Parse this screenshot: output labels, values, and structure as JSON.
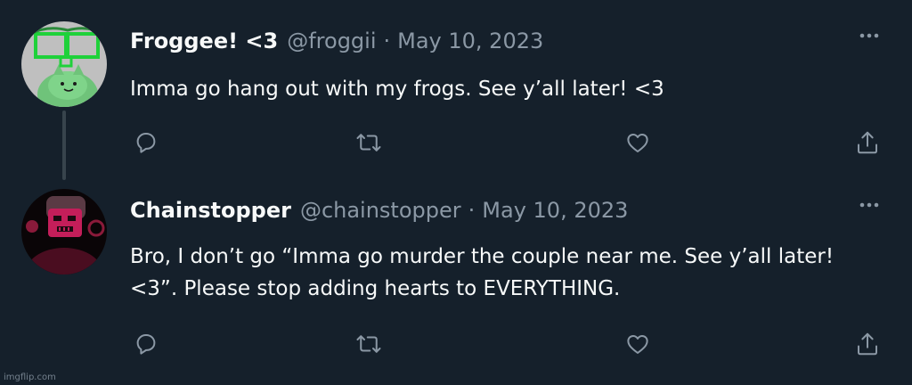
{
  "colors": {
    "background": "#15202b",
    "primary_text": "#f7f9f9",
    "secondary_text": "#8b98a5",
    "thread_line": "#38444d"
  },
  "tweets": [
    {
      "display_name": "Froggee! <3",
      "handle": "@froggii",
      "separator": "·",
      "date": "May 10, 2023",
      "text": "Imma go hang out with my frogs. See y’all later! <3"
    },
    {
      "display_name": "Chainstopper",
      "handle": "@chainstopper",
      "separator": "·",
      "date": "May 10, 2023",
      "text": "Bro, I don’t go “Imma go murder the couple near me. See y’all later! <3”. Please stop adding hearts to EVERYTHING."
    }
  ],
  "icons": [
    "reply-icon",
    "retweet-icon",
    "like-icon",
    "share-icon",
    "more-icon"
  ],
  "watermark": "imgflip.com"
}
